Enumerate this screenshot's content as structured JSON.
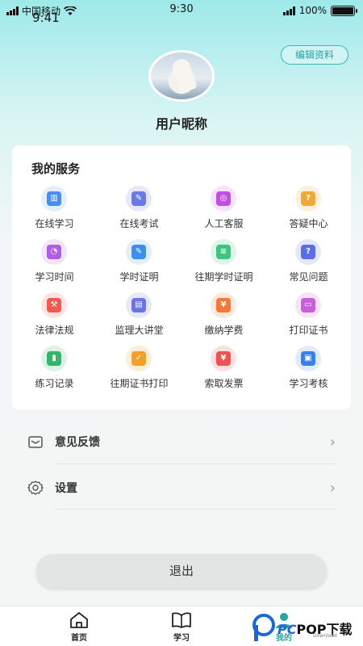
{
  "status_bar": {
    "carrier": "中国移动",
    "time_overlay": "9:41",
    "time": "9:30",
    "battery": "100%"
  },
  "profile": {
    "edit_label": "编辑资料",
    "nickname": "用户昵称"
  },
  "services": {
    "title": "我的服务",
    "items": [
      {
        "label": "在线学习",
        "icon": "book-icon",
        "color": "#4a8ff0",
        "bg": "#e4eefc"
      },
      {
        "label": "在线考试",
        "icon": "exam-icon",
        "color": "#6a79e8",
        "bg": "#e7e9fb"
      },
      {
        "label": "人工客服",
        "icon": "headset-icon",
        "color": "#c14fe0",
        "bg": "#f5e4fb"
      },
      {
        "label": "答疑中心",
        "icon": "qa-icon",
        "color": "#f0a83a",
        "bg": "#fdf0dc"
      },
      {
        "label": "学习时间",
        "icon": "clock-icon",
        "color": "#b05ee6",
        "bg": "#f1e4fb"
      },
      {
        "label": "学时证明",
        "icon": "certificate-edit-icon",
        "color": "#3b8ff0",
        "bg": "#e2eefc"
      },
      {
        "label": "往期学时证明",
        "icon": "document-icon",
        "color": "#3ec47e",
        "bg": "#def5e8"
      },
      {
        "label": "常见问题",
        "icon": "question-icon",
        "color": "#5a6ee6",
        "bg": "#e5e8fb"
      },
      {
        "label": "法律法规",
        "icon": "gavel-icon",
        "color": "#ef5a52",
        "bg": "#fde3e1"
      },
      {
        "label": "监理大讲堂",
        "icon": "lecture-icon",
        "color": "#6a74e8",
        "bg": "#e6e8fb"
      },
      {
        "label": "缴纳学费",
        "icon": "payment-icon",
        "color": "#f07a3a",
        "bg": "#fde9dc"
      },
      {
        "label": "打印证书",
        "icon": "printer-icon",
        "color": "#c85ed8",
        "bg": "#f6e3f8"
      },
      {
        "label": "练习记录",
        "icon": "record-icon",
        "color": "#34b56a",
        "bg": "#ddf3e5"
      },
      {
        "label": "往期证书打印",
        "icon": "certificate-print-icon",
        "color": "#f2a02a",
        "bg": "#fdeed8"
      },
      {
        "label": "索取发票",
        "icon": "invoice-icon",
        "color": "#ef5050",
        "bg": "#fde1e1"
      },
      {
        "label": "学习考核",
        "icon": "assessment-icon",
        "color": "#3a7fe8",
        "bg": "#e1ebfb"
      }
    ]
  },
  "menu": {
    "feedback_label": "意见反馈",
    "settings_label": "设置"
  },
  "logout_label": "退出",
  "tabbar": {
    "home_label": "首页",
    "study_label": "学习",
    "mine_label": "我的"
  },
  "watermark": {
    "brand_blue": "PC",
    "brand_rest": "POP下载",
    "sub": "Download"
  }
}
